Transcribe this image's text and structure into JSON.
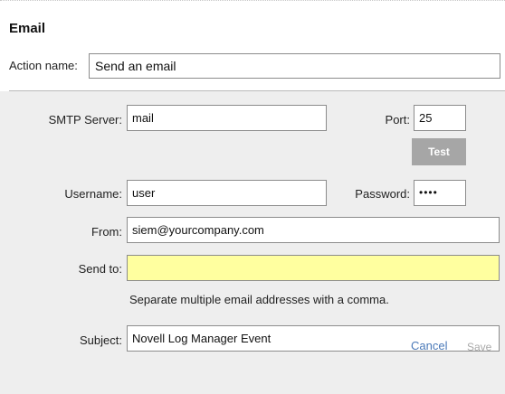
{
  "dialog": {
    "title": "Email",
    "action_name_label": "Action name:",
    "action_name_value": "Send an email"
  },
  "form": {
    "smtp_label": "SMTP Server:",
    "smtp_value": "mail",
    "port_label": "Port:",
    "port_value": "25",
    "test_label": "Test",
    "username_label": "Username:",
    "username_value": "user",
    "password_label": "Password:",
    "password_value": "••••",
    "from_label": "From:",
    "from_value": "siem@yourcompany.com",
    "send_to_label": "Send to:",
    "send_to_value": "",
    "send_to_hint": "Separate multiple email addresses with a comma.",
    "subject_label": "Subject:",
    "subject_value": "Novell Log Manager Event"
  },
  "footer": {
    "cancel_label": "Cancel",
    "save_label": "Save"
  },
  "colors": {
    "body_bg": "#eeeeee",
    "highlight_field": "#ffff9f",
    "link": "#4a79b8",
    "test_button": "#a6a6a6"
  }
}
